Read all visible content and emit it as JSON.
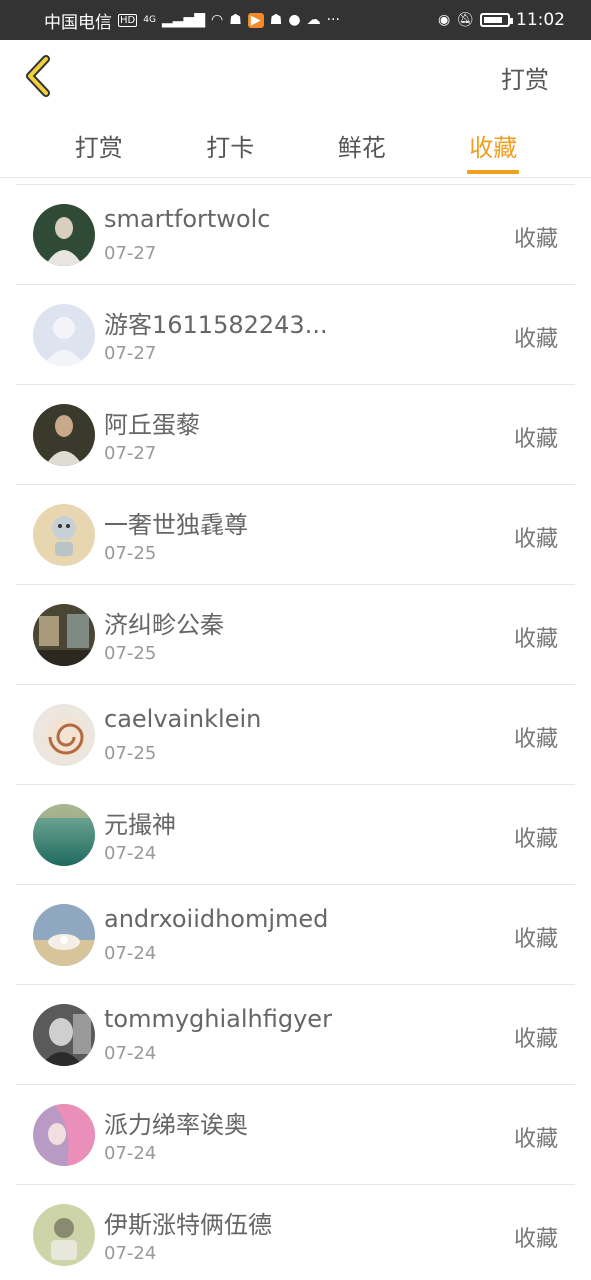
{
  "status_bar": {
    "carrier": "中国电信",
    "hd": "HD",
    "network": "4G",
    "time": "11:02",
    "more": "···"
  },
  "header": {
    "back_icon": "chevron-left-icon",
    "right_label": "打赏",
    "accent_color": "#f0a020"
  },
  "tabs": [
    {
      "label": "打赏",
      "active": false
    },
    {
      "label": "打卡",
      "active": false
    },
    {
      "label": "鲜花",
      "active": false
    },
    {
      "label": "收藏",
      "active": true
    }
  ],
  "list": [
    {
      "name": "smartfortwolc",
      "date": "07-27",
      "action": "收藏"
    },
    {
      "name": "游客1611582243...",
      "date": "07-27",
      "action": "收藏"
    },
    {
      "name": "阿丘蛋藜",
      "date": "07-27",
      "action": "收藏"
    },
    {
      "name": "一奢世独毳尊",
      "date": "07-25",
      "action": "收藏"
    },
    {
      "name": "济纠畛公秦",
      "date": "07-25",
      "action": "收藏"
    },
    {
      "name": "caelvainklein",
      "date": "07-25",
      "action": "收藏"
    },
    {
      "name": "元撮神",
      "date": "07-24",
      "action": "收藏"
    },
    {
      "name": "andrxoiidhomjmed",
      "date": "07-24",
      "action": "收藏"
    },
    {
      "name": "tommyghialhfigyer",
      "date": "07-24",
      "action": "收藏"
    },
    {
      "name": "派力绨率诶奥",
      "date": "07-24",
      "action": "收藏"
    },
    {
      "name": "伊斯涨特俩伍德",
      "date": "07-24",
      "action": "收藏"
    }
  ]
}
